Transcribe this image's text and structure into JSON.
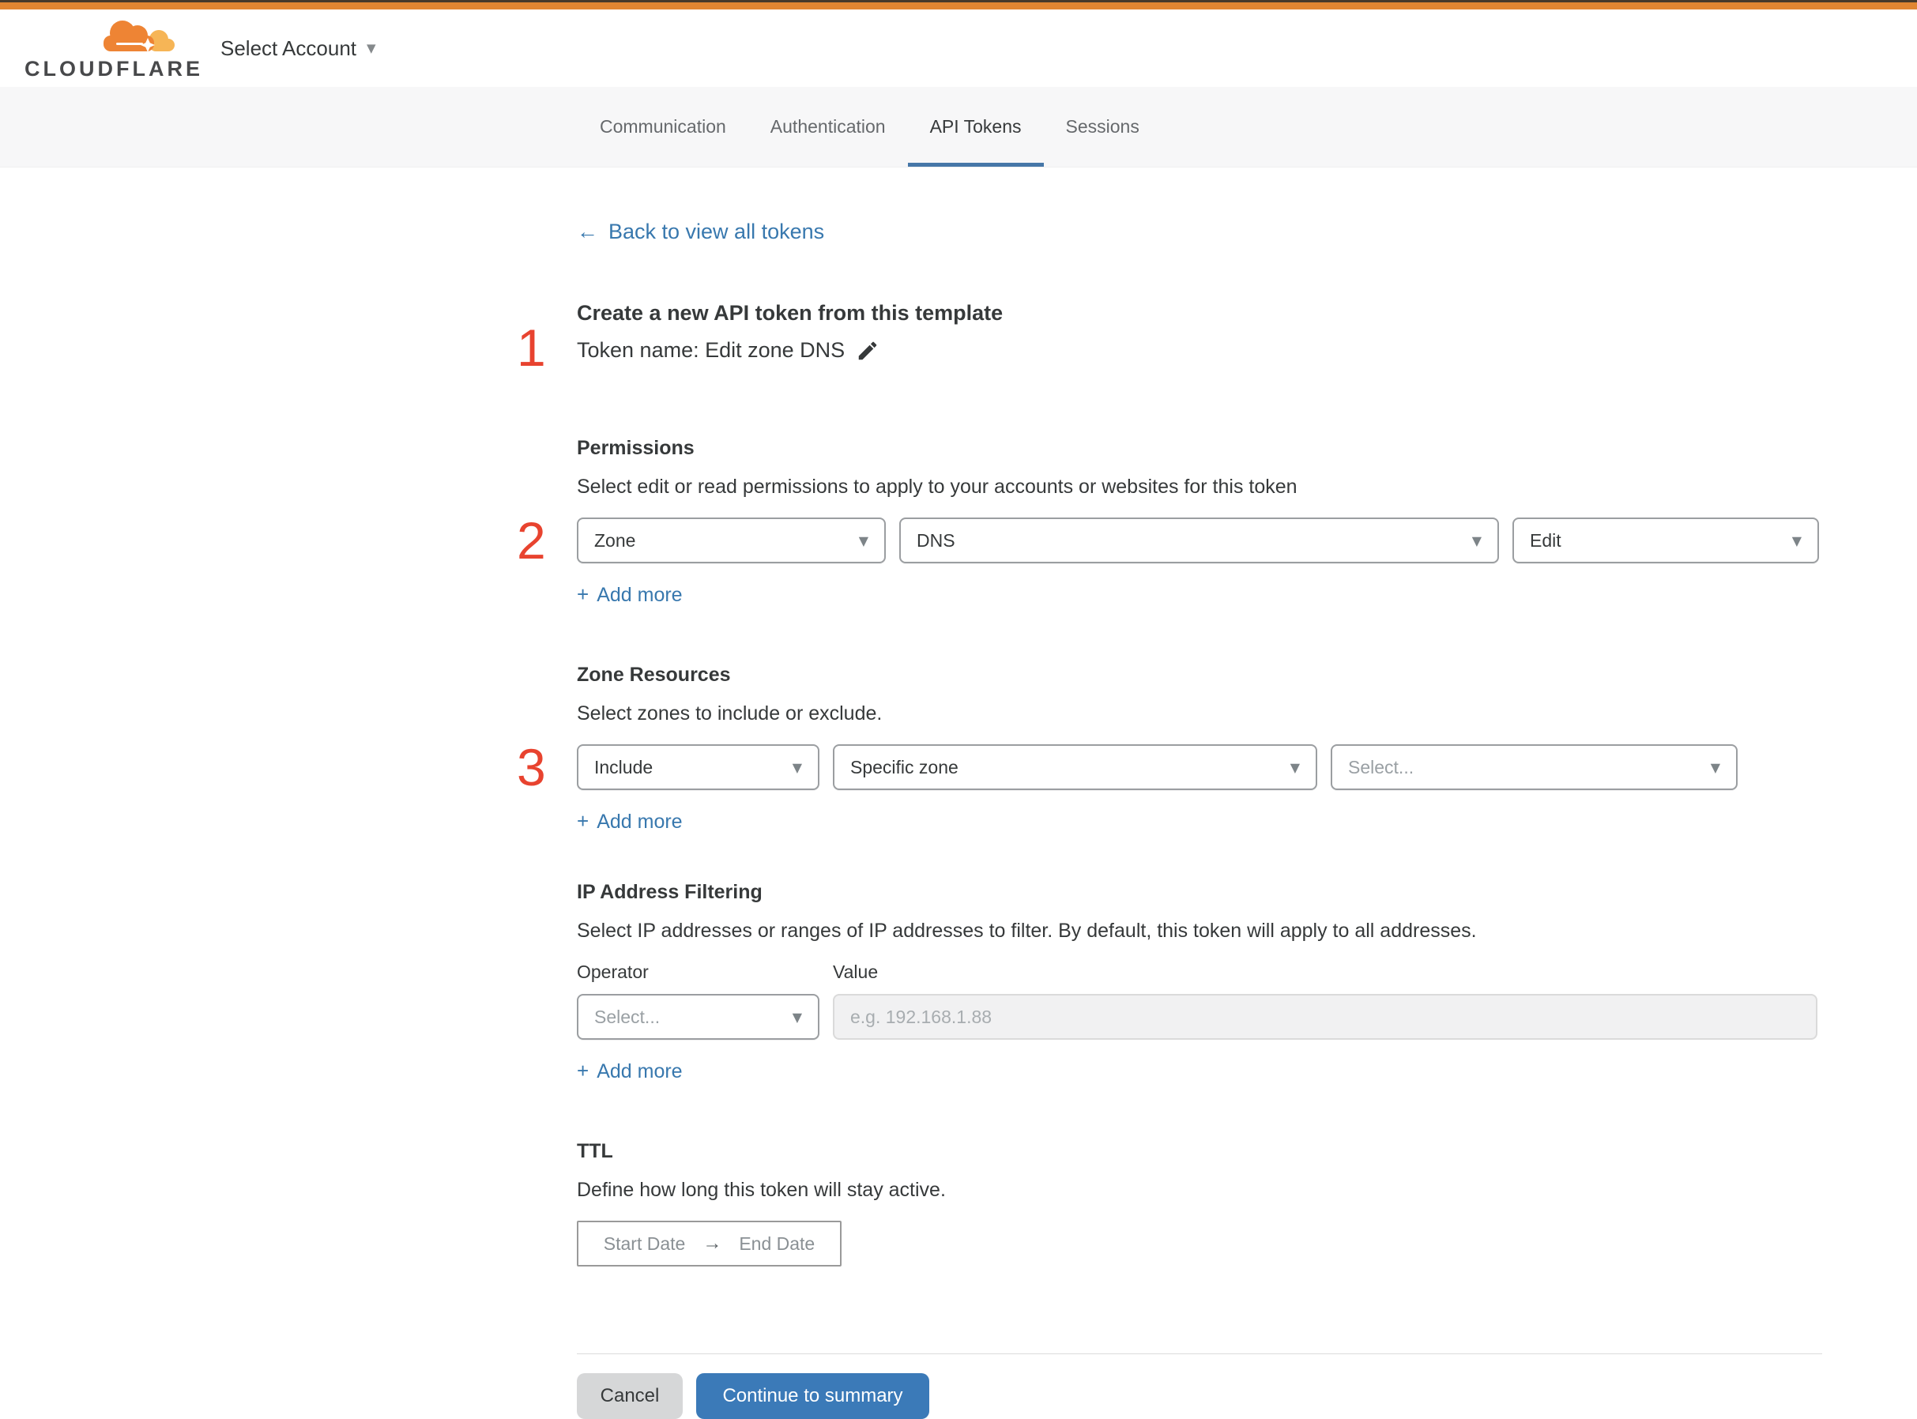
{
  "header": {
    "logo_text": "CLOUDFLARE",
    "account_selector_label": "Select Account"
  },
  "tabs": [
    {
      "label": "Communication",
      "active": false
    },
    {
      "label": "Authentication",
      "active": false
    },
    {
      "label": "API Tokens",
      "active": true
    },
    {
      "label": "Sessions",
      "active": false
    }
  ],
  "back_link": {
    "label": "Back to view all tokens"
  },
  "token_section": {
    "step": "1",
    "title": "Create a new API token from this template",
    "token_name": "Token name: Edit zone DNS"
  },
  "permissions": {
    "step": "2",
    "heading": "Permissions",
    "description": "Select edit or read permissions to apply to your accounts or websites for this token",
    "scope_value": "Zone",
    "service_value": "DNS",
    "access_value": "Edit",
    "add_more_label": "Add more"
  },
  "zone_resources": {
    "step": "3",
    "heading": "Zone Resources",
    "description": "Select zones to include or exclude.",
    "mode_value": "Include",
    "scope_value": "Specific zone",
    "zone_placeholder": "Select...",
    "add_more_label": "Add more"
  },
  "ip_filtering": {
    "heading": "IP Address Filtering",
    "description": "Select IP addresses or ranges of IP addresses to filter. By default, this token will apply to all addresses.",
    "operator_label": "Operator",
    "value_label": "Value",
    "operator_placeholder": "Select...",
    "value_placeholder": "e.g. 192.168.1.88",
    "add_more_label": "Add more"
  },
  "ttl": {
    "heading": "TTL",
    "description": "Define how long this token will stay active.",
    "start_label": "Start Date",
    "end_label": "End Date"
  },
  "footer": {
    "cancel_label": "Cancel",
    "continue_label": "Continue to summary"
  },
  "icons": {
    "plus": "+",
    "back_arrow": "←",
    "right_arrow": "→",
    "chevron_down": "▼"
  },
  "colors": {
    "top_bar_orange": "#e08632",
    "logo_orange": "#ee8434",
    "logo_light_orange": "#f6b556",
    "link_blue": "#3878ae",
    "tab_underline_blue": "#4677a8",
    "continue_button_blue": "#3b7ab8",
    "step_number_red": "#e8432f",
    "tab_bar_background": "#f7f7f8"
  }
}
